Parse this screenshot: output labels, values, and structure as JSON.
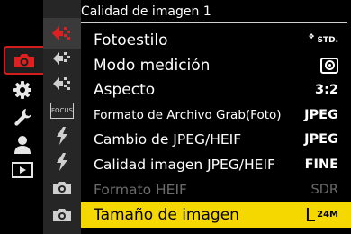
{
  "colors": {
    "accent": "#d41c1c",
    "selected_bg": "#f5d800",
    "tab_bg": "#262626"
  },
  "categories": [
    {
      "name": "camera-icon",
      "active": true
    },
    {
      "name": "gear-icon",
      "active": false
    },
    {
      "name": "wrench-icon",
      "active": false
    },
    {
      "name": "person-icon",
      "active": false
    },
    {
      "name": "playback-icon",
      "active": false
    }
  ],
  "tabs": [
    {
      "name": "tab-1",
      "active": true
    },
    {
      "name": "tab-2",
      "active": false
    },
    {
      "name": "tab-3",
      "active": false
    },
    {
      "name": "tab-focus",
      "label": "FOCUS",
      "active": false
    },
    {
      "name": "tab-flash-1",
      "active": false
    },
    {
      "name": "tab-flash-2",
      "active": false
    },
    {
      "name": "tab-cam-1",
      "active": false
    },
    {
      "name": "tab-cam-2",
      "active": false
    }
  ],
  "menu": {
    "title": "Calidad de imagen 1",
    "items": [
      {
        "label": "Fotoestilo",
        "value": "STD.",
        "value_type": "std-badge"
      },
      {
        "label": "Modo medición",
        "value": "",
        "value_type": "metering-icon"
      },
      {
        "label": "Aspecto",
        "value": "3:2"
      },
      {
        "label": "Formato de Archivo Grab(Foto)",
        "value": "JPEG"
      },
      {
        "label": "Cambio de JPEG/HEIF",
        "value": "JPEG"
      },
      {
        "label": "Calidad imagen JPEG/HEIF",
        "value": "FINE"
      },
      {
        "label": "Formato HEIF",
        "value": "SDR",
        "disabled": true
      },
      {
        "label": "Tamaño de imagen",
        "value_big": "L",
        "value_small": "24M",
        "selected": true
      }
    ]
  }
}
